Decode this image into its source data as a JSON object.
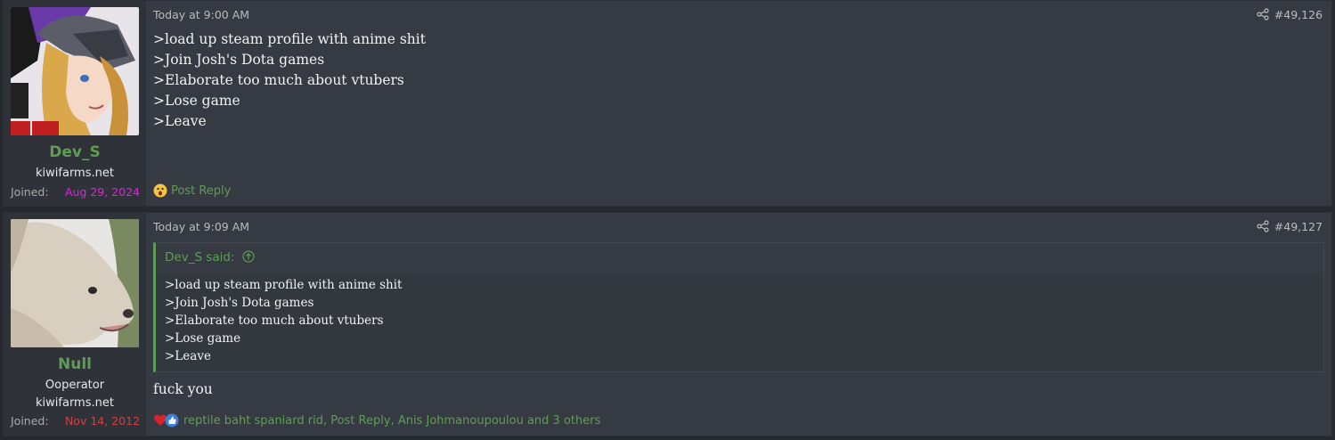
{
  "posts": [
    {
      "username": "Dev_S",
      "user_title": "kiwifarms.net",
      "joined_label": "Joined:",
      "joined_date": "Aug 29, 2024",
      "joined_color": "#e020e0",
      "timestamp": "Today at 9:00 AM",
      "post_number": "#49,126",
      "avatar_icon": "anime-avatar",
      "body_lines": [
        ">load up steam profile with anime shit",
        ">Join Josh's Dota games",
        ">Elaborate too much about vtubers",
        ">Lose game",
        ">Leave"
      ],
      "reaction_icon": "shocked-emoji-icon",
      "reaction_text": "Post Reply"
    },
    {
      "username": "Null",
      "user_title": "Ooperator",
      "user_subtitle": "kiwifarms.net",
      "joined_label": "Joined:",
      "joined_date": "Nov 14, 2012",
      "joined_color": "#d04040",
      "timestamp": "Today at 9:09 AM",
      "post_number": "#49,127",
      "avatar_icon": "dog-avatar",
      "quote_author": "Dev_S said:",
      "quote_lines": [
        ">load up steam profile with anime shit",
        ">Join Josh's Dota games",
        ">Elaborate too much about vtubers",
        ">Lose game",
        ">Leave"
      ],
      "body_lines": [
        "fuck you"
      ],
      "reaction_icons": [
        "heart-icon",
        "thumbs-up-icon"
      ],
      "reaction_text": "reptile baht spaniard rid, Post Reply, Anis Johmanoupoulou and 3 others"
    }
  ],
  "colors": {
    "username": "#5d9e54",
    "accent": "#5d9e54",
    "background": "#26292e",
    "post_bg": "#363a42"
  }
}
